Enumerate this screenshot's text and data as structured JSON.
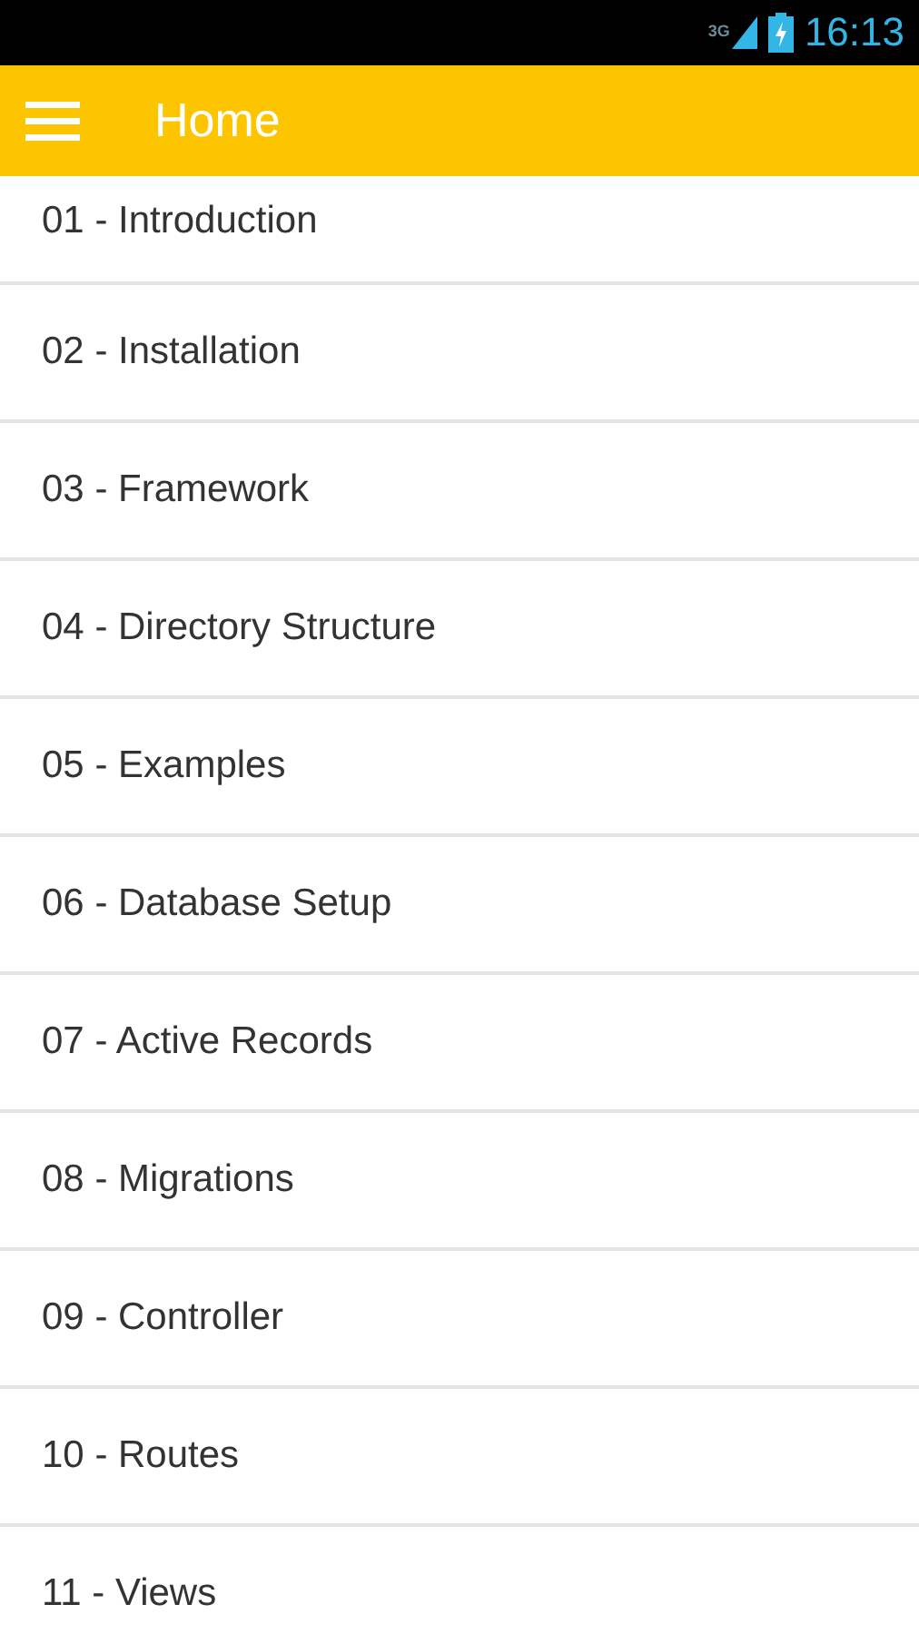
{
  "status_bar": {
    "network": "3G",
    "time": "16:13"
  },
  "app_bar": {
    "title": "Home"
  },
  "items": [
    {
      "label": "01 - Introduction"
    },
    {
      "label": "02 - Installation"
    },
    {
      "label": "03 - Framework"
    },
    {
      "label": "04 - Directory Structure"
    },
    {
      "label": "05 - Examples"
    },
    {
      "label": "06 - Database Setup"
    },
    {
      "label": "07 - Active Records"
    },
    {
      "label": "08 - Migrations"
    },
    {
      "label": "09 - Controller"
    },
    {
      "label": "10 - Routes"
    },
    {
      "label": "11 - Views"
    }
  ]
}
